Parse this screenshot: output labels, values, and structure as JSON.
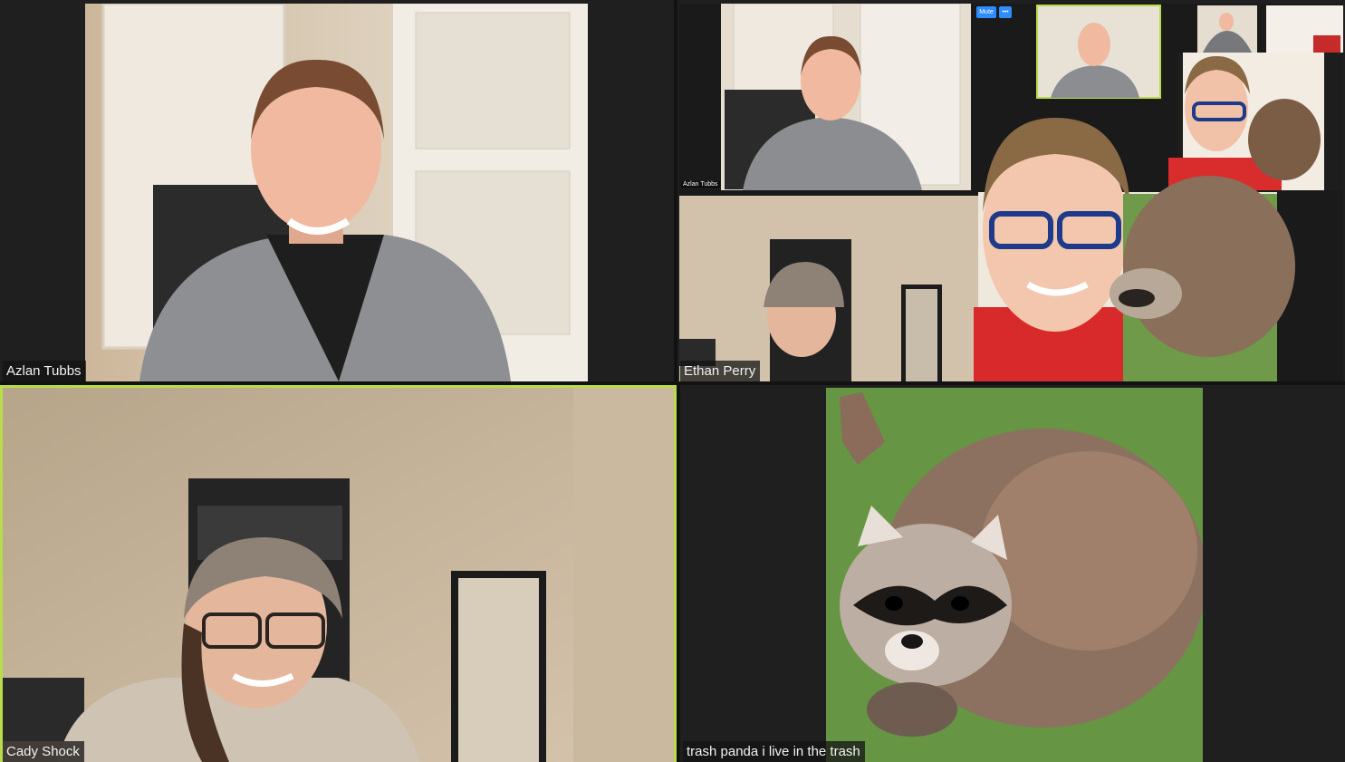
{
  "participants": [
    {
      "name": "Azlan Tubbs"
    },
    {
      "name": "Ethan Perry"
    },
    {
      "name": "Cady Shock"
    },
    {
      "name": "trash panda i live in the trash"
    }
  ],
  "nested": {
    "mini_label": "Azlan Tubbs",
    "mute_label": "Mute",
    "more_label": "•••"
  },
  "colors": {
    "active_speaker_border": "#b9dc4a",
    "tile_background": "#1f1f1f",
    "button_blue": "#2d8cff"
  }
}
